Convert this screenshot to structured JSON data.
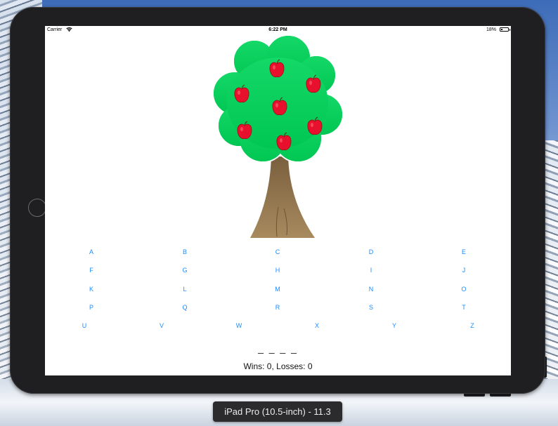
{
  "status_bar": {
    "carrier": "Carrier",
    "time": "6:22 PM",
    "battery": "18%",
    "battery_level": 0.18
  },
  "game": {
    "apple_count": 7,
    "letters": [
      "A",
      "B",
      "C",
      "D",
      "E",
      "F",
      "G",
      "H",
      "I",
      "J",
      "K",
      "L",
      "M",
      "N",
      "O",
      "P",
      "Q",
      "R",
      "S",
      "T",
      "U",
      "V",
      "W",
      "X",
      "Y",
      "Z"
    ],
    "word": "_ _ _ _",
    "score": "Wins: 0, Losses: 0"
  },
  "simulator": {
    "device_label": "iPad Pro (10.5-inch) - 11.3"
  },
  "colors": {
    "accent": "#1a8cff",
    "leaves": "#00cc55",
    "apple": "#e8112d",
    "trunk": "#94774f"
  }
}
